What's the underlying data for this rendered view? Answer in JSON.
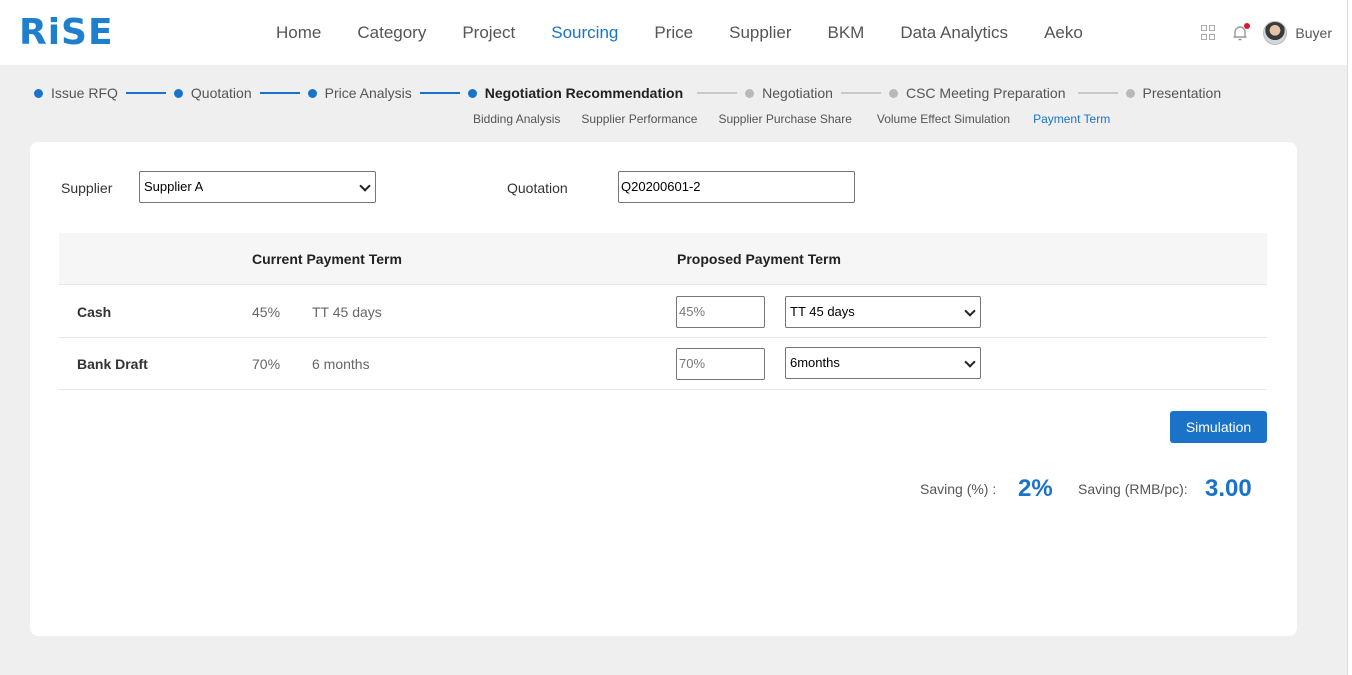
{
  "app": {
    "logo": "RiSE"
  },
  "nav": {
    "items": [
      {
        "label": "Home"
      },
      {
        "label": "Category"
      },
      {
        "label": "Project"
      },
      {
        "label": "Sourcing",
        "active": true
      },
      {
        "label": "Price"
      },
      {
        "label": "Supplier"
      },
      {
        "label": "BKM"
      },
      {
        "label": "Data Analytics"
      },
      {
        "label": "Aeko"
      }
    ],
    "user": "Buyer"
  },
  "steps": {
    "items": [
      {
        "label": "Issue RFQ",
        "status": "done"
      },
      {
        "label": "Quotation",
        "status": "done"
      },
      {
        "label": "Price Analysis",
        "status": "done"
      },
      {
        "label": "Negotiation Recommendation",
        "status": "current"
      },
      {
        "label": "Negotiation",
        "status": "pending"
      },
      {
        "label": "CSC Meeting Preparation",
        "status": "pending"
      },
      {
        "label": "Presentation",
        "status": "pending"
      }
    ],
    "subtabs": [
      {
        "label": "Bidding Analysis"
      },
      {
        "label": "Supplier Performance"
      },
      {
        "label": "Supplier Purchase Share"
      },
      {
        "label": "Volume Effect Simulation"
      },
      {
        "label": "Payment Term",
        "active": true
      }
    ]
  },
  "form": {
    "supplier_label": "Supplier",
    "supplier_value": "Supplier A",
    "quotation_label": "Quotation",
    "quotation_value": "Q20200601-2"
  },
  "table": {
    "headers": {
      "current": "Current Payment Term",
      "proposed": "Proposed Payment Term"
    },
    "rows": [
      {
        "name": "Cash",
        "current_pct": "45%",
        "current_term": "TT 45 days",
        "proposed_pct": "45%",
        "proposed_term": "TT 45 days"
      },
      {
        "name": "Bank Draft",
        "current_pct": "70%",
        "current_term": "6 months",
        "proposed_pct": "70%",
        "proposed_term": "6months"
      }
    ]
  },
  "actions": {
    "simulation": "Simulation"
  },
  "result": {
    "saving_pct_label": "Saving (%) :",
    "saving_pct_value": "2%",
    "saving_rmb_label": "Saving (RMB/pc):",
    "saving_rmb_value": "3.00"
  },
  "colors": {
    "accent": "#1a73c9",
    "background": "#efefef",
    "notification": "#e0162b"
  }
}
